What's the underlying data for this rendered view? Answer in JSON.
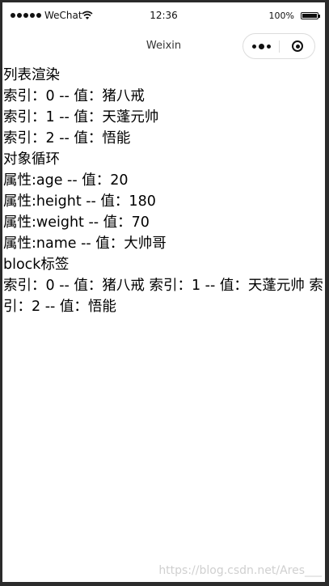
{
  "status_bar": {
    "carrier": "WeChat",
    "time": "12:36",
    "battery": "100%"
  },
  "nav_bar": {
    "title": "Weixin",
    "more_icon": "more-dots-icon",
    "close_icon": "close-circle-icon"
  },
  "content": {
    "list_render_heading": "列表渲染",
    "list_items": [
      "索引：0 -- 值：猪八戒",
      "索引：1 -- 值：天蓬元帅",
      "索引：2 -- 值：悟能"
    ],
    "object_loop_heading": "对象循环",
    "object_items": [
      "属性:age -- 值：20",
      "属性:height -- 值：180",
      "属性:weight -- 值：70",
      "属性:name -- 值：大帅哥"
    ],
    "block_heading": "block标签",
    "block_text": "索引：0 -- 值：猪八戒 索引：1 -- 值：天蓬元帅 索引：2 -- 值：悟能"
  },
  "watermark": "https://blog.csdn.net/Ares___"
}
